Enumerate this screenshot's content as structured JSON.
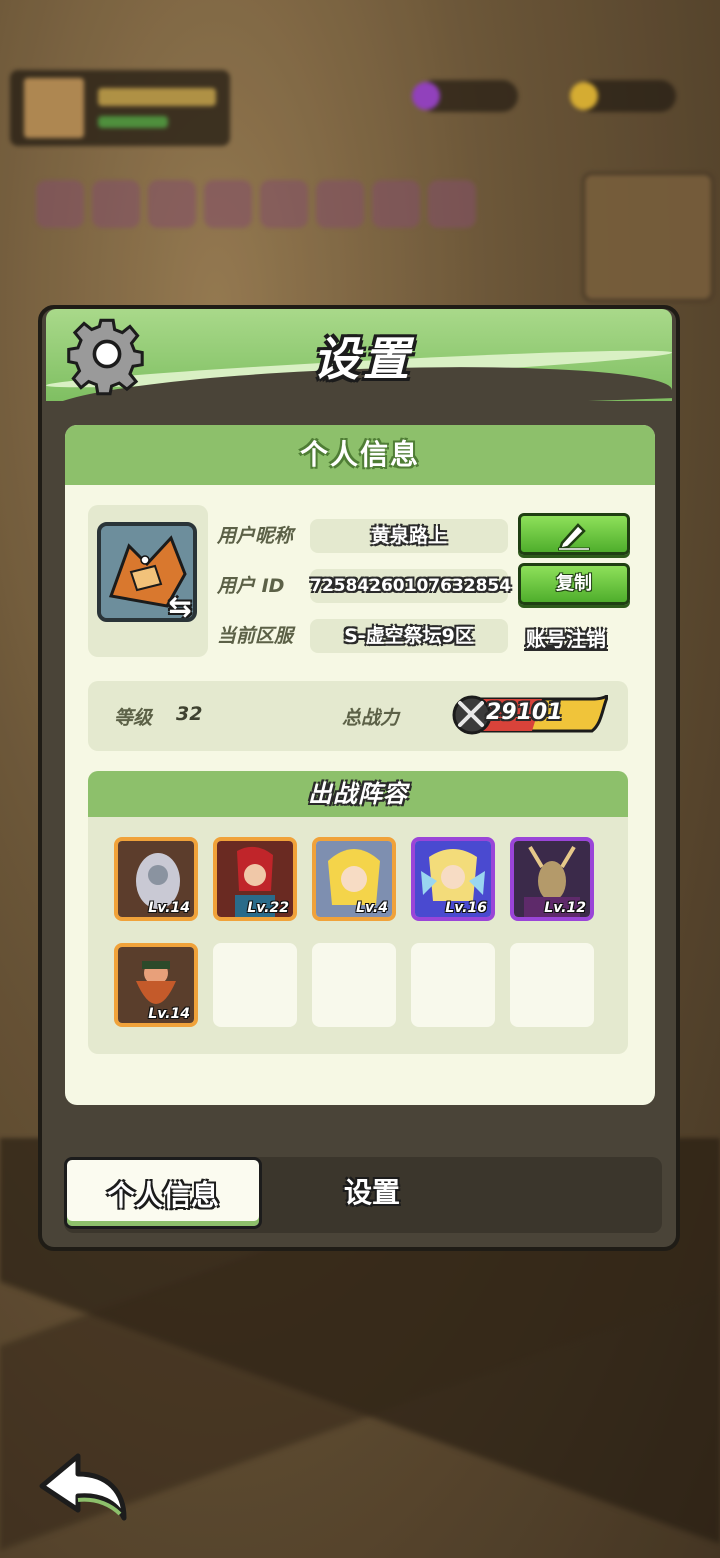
{
  "dialog": {
    "title": "设置",
    "section_title": "个人信息"
  },
  "profile": {
    "nickname_label": "用户昵称",
    "nickname": "黄泉路上",
    "id_label": "用户  ID",
    "user_id": "72584260107632854",
    "copy_label": "复制",
    "server_label": "当前区服",
    "server": "S-虚空祭坛9区",
    "delete_account_label": "账号注销"
  },
  "stats": {
    "level_label": "等级",
    "level": "32",
    "power_label": "总战力",
    "power": "29101"
  },
  "lineup": {
    "title": "出战阵容",
    "heroes": [
      {
        "level": "Lv.14",
        "rarity": "orange"
      },
      {
        "level": "Lv.22",
        "rarity": "orange"
      },
      {
        "level": "Lv.4",
        "rarity": "orange"
      },
      {
        "level": "Lv.16",
        "rarity": "purple"
      },
      {
        "level": "Lv.12",
        "rarity": "purple"
      },
      {
        "level": "Lv.14",
        "rarity": "orange"
      }
    ],
    "empty_slots": 4
  },
  "tabs": {
    "personal": "个人信息",
    "settings": "设置"
  },
  "icons": {
    "settings": "gear-icon",
    "edit": "pencil-icon",
    "swap": "swap-arrows-icon",
    "power": "crossed-swords-icon",
    "back": "back-arrow-icon"
  },
  "colors": {
    "accent_green": "#8dc06b",
    "panel_bg": "#f6f8e4",
    "rarity_orange": "#f0a23a",
    "rarity_purple": "#9a45d8"
  }
}
